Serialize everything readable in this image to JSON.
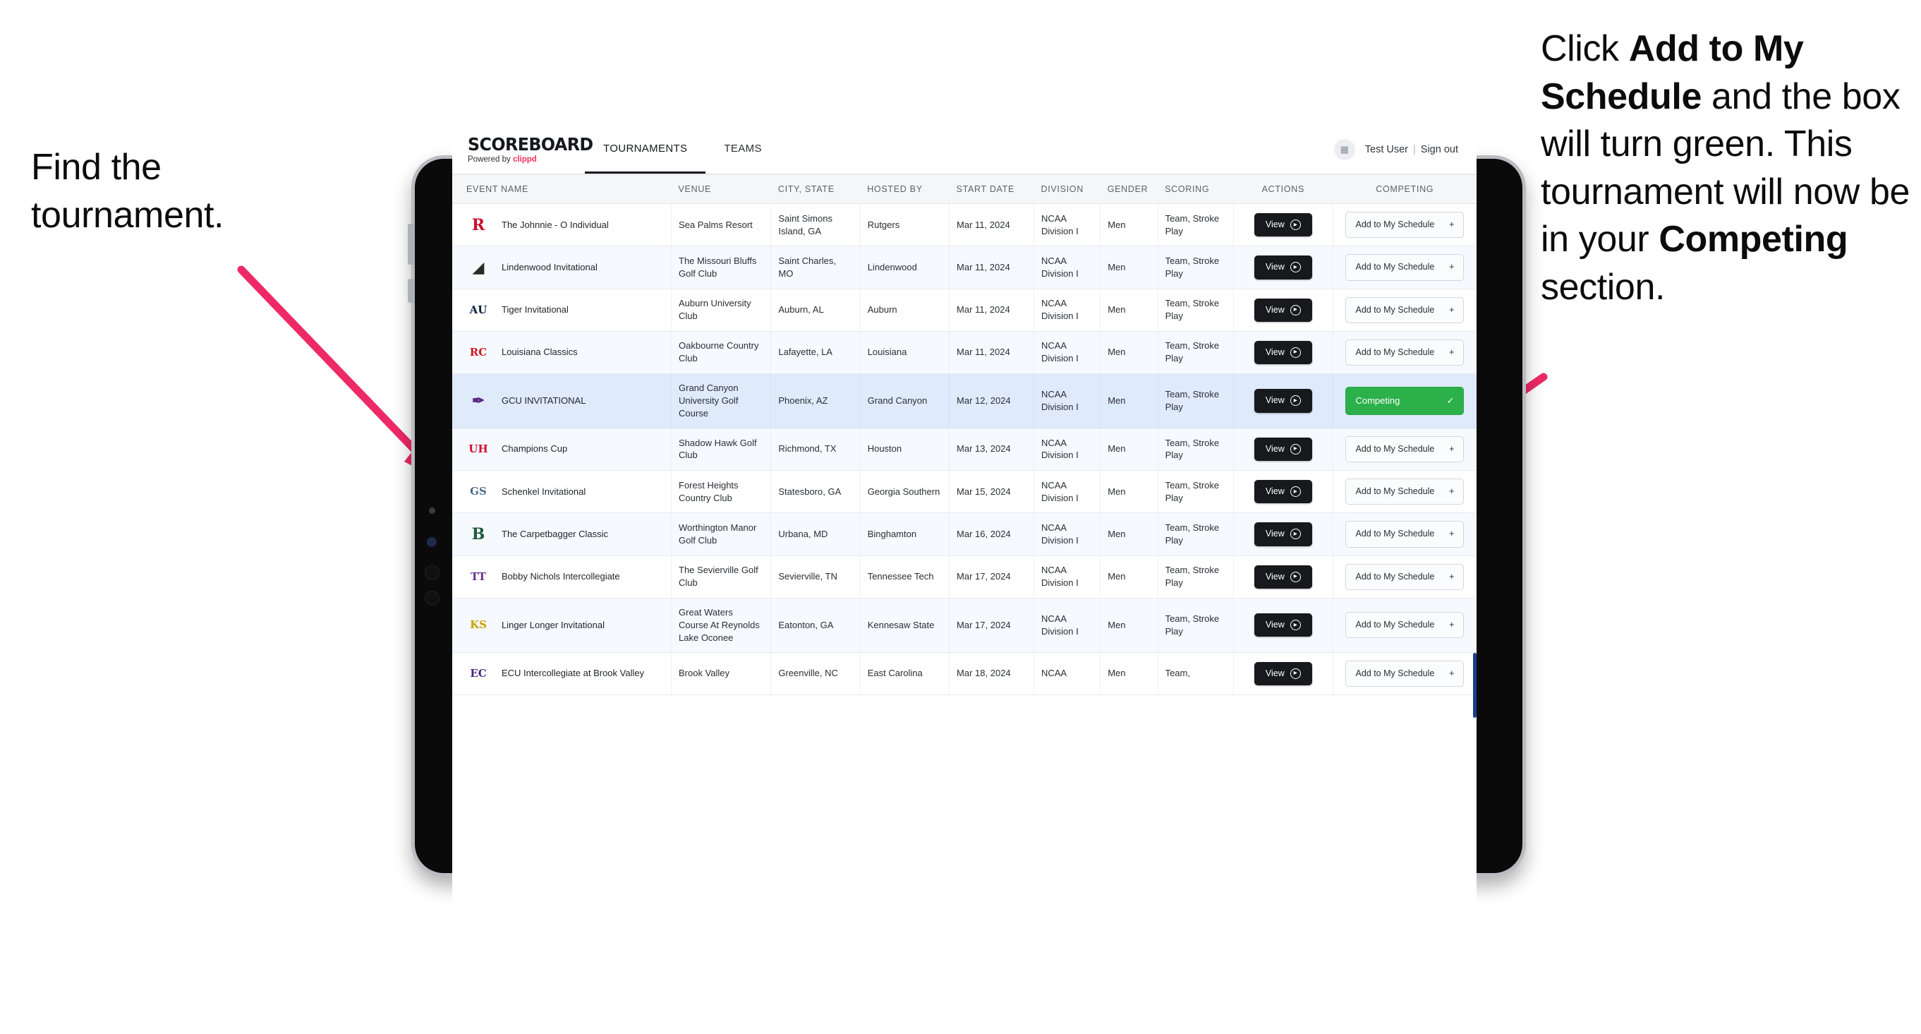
{
  "annotations": {
    "left": "Find the tournament.",
    "right_parts": [
      {
        "text": "Click ",
        "bold": false
      },
      {
        "text": "Add to My Schedule",
        "bold": true
      },
      {
        "text": " and the box will turn green. This tournament will now be in your ",
        "bold": false
      },
      {
        "text": "Competing",
        "bold": true
      },
      {
        "text": " section.",
        "bold": false
      }
    ],
    "arrow_color": "#ED2A67"
  },
  "app": {
    "brand": {
      "title": "SCOREBOARD",
      "powered_prefix": "Powered by ",
      "powered_brand": "clippd"
    },
    "nav": [
      {
        "label": "TOURNAMENTS",
        "active": true
      },
      {
        "label": "TEAMS",
        "active": false
      }
    ],
    "header_right": {
      "avatar_icon": "user-avatar-icon",
      "user_name": "Test User",
      "separator": "|",
      "sign_out": "Sign out"
    },
    "colors": {
      "accent_pink": "#f0325c",
      "competing_green": "#2bb04a",
      "view_black": "#18191c",
      "selected_row": "#dfeaFB"
    },
    "table": {
      "columns": [
        "EVENT NAME",
        "VENUE",
        "CITY, STATE",
        "HOSTED BY",
        "START DATE",
        "DIVISION",
        "GENDER",
        "SCORING",
        "ACTIONS",
        "COMPETING"
      ],
      "view_label": "View",
      "add_label": "Add to My Schedule",
      "add_icon": "plus-icon",
      "competing_label": "Competing",
      "competing_icon": "check-icon",
      "rows": [
        {
          "logo": {
            "text": "R",
            "color": "#c8102e",
            "bg": "transparent",
            "name": "rutgers-logo"
          },
          "event": "The Johnnie - O Individual",
          "venue": "Sea Palms Resort",
          "city": "Saint Simons Island, GA",
          "host": "Rutgers",
          "date": "Mar 11, 2024",
          "division": "NCAA Division I",
          "gender": "Men",
          "scoring": "Team, Stroke Play",
          "competing": false
        },
        {
          "logo": {
            "text": "◢",
            "color": "#2b2a22",
            "bg": "transparent",
            "name": "lindenwood-lion-logo"
          },
          "event": "Lindenwood Invitational",
          "venue": "The Missouri Bluffs Golf Club",
          "city": "Saint Charles, MO",
          "host": "Lindenwood",
          "date": "Mar 11, 2024",
          "division": "NCAA Division I",
          "gender": "Men",
          "scoring": "Team, Stroke Play",
          "competing": false
        },
        {
          "logo": {
            "text": "AU",
            "color": "#0c2340",
            "bg": "transparent",
            "name": "auburn-logo"
          },
          "event": "Tiger Invitational",
          "venue": "Auburn University Club",
          "city": "Auburn, AL",
          "host": "Auburn",
          "date": "Mar 11, 2024",
          "division": "NCAA Division I",
          "gender": "Men",
          "scoring": "Team, Stroke Play",
          "competing": false
        },
        {
          "logo": {
            "text": "RC",
            "color": "#ce181e",
            "bg": "transparent",
            "name": "louisiana-ragin-cajuns-logo"
          },
          "event": "Louisiana Classics",
          "venue": "Oakbourne Country Club",
          "city": "Lafayette, LA",
          "host": "Louisiana",
          "date": "Mar 11, 2024",
          "division": "NCAA Division I",
          "gender": "Men",
          "scoring": "Team, Stroke Play",
          "competing": false
        },
        {
          "logo": {
            "text": "✒",
            "color": "#582c83",
            "bg": "transparent",
            "name": "grand-canyon-lopes-logo"
          },
          "event": "GCU INVITATIONAL",
          "venue": "Grand Canyon University Golf Course",
          "city": "Phoenix, AZ",
          "host": "Grand Canyon",
          "date": "Mar 12, 2024",
          "division": "NCAA Division I",
          "gender": "Men",
          "scoring": "Team, Stroke Play",
          "competing": true
        },
        {
          "logo": {
            "text": "UH",
            "color": "#c8102e",
            "bg": "transparent",
            "name": "houston-logo"
          },
          "event": "Champions Cup",
          "venue": "Shadow Hawk Golf Club",
          "city": "Richmond, TX",
          "host": "Houston",
          "date": "Mar 13, 2024",
          "division": "NCAA Division I",
          "gender": "Men",
          "scoring": "Team, Stroke Play",
          "competing": false
        },
        {
          "logo": {
            "text": "GS",
            "color": "#4a6e8f",
            "bg": "transparent",
            "name": "georgia-southern-logo"
          },
          "event": "Schenkel Invitational",
          "venue": "Forest Heights Country Club",
          "city": "Statesboro, GA",
          "host": "Georgia Southern",
          "date": "Mar 15, 2024",
          "division": "NCAA Division I",
          "gender": "Men",
          "scoring": "Team, Stroke Play",
          "competing": false
        },
        {
          "logo": {
            "text": "B",
            "color": "#1c5a3c",
            "bg": "transparent",
            "name": "binghamton-logo"
          },
          "event": "The Carpetbagger Classic",
          "venue": "Worthington Manor Golf Club",
          "city": "Urbana, MD",
          "host": "Binghamton",
          "date": "Mar 16, 2024",
          "division": "NCAA Division I",
          "gender": "Men",
          "scoring": "Team, Stroke Play",
          "competing": false
        },
        {
          "logo": {
            "text": "TT",
            "color": "#6b2d8b",
            "bg": "transparent",
            "name": "tennessee-tech-golden-eagle-logo"
          },
          "event": "Bobby Nichols Intercollegiate",
          "venue": "The Sevierville Golf Club",
          "city": "Sevierville, TN",
          "host": "Tennessee Tech",
          "date": "Mar 17, 2024",
          "division": "NCAA Division I",
          "gender": "Men",
          "scoring": "Team, Stroke Play",
          "competing": false
        },
        {
          "logo": {
            "text": "KS",
            "color": "#c8a200",
            "bg": "transparent",
            "name": "kennesaw-state-logo"
          },
          "event": "Linger Longer Invitational",
          "venue": "Great Waters Course At Reynolds Lake Oconee",
          "city": "Eatonton, GA",
          "host": "Kennesaw State",
          "date": "Mar 17, 2024",
          "division": "NCAA Division I",
          "gender": "Men",
          "scoring": "Team, Stroke Play",
          "competing": false
        },
        {
          "logo": {
            "text": "EC",
            "color": "#4b2682",
            "bg": "transparent",
            "name": "east-carolina-logo"
          },
          "event": "ECU Intercollegiate at Brook Valley",
          "venue": "Brook Valley",
          "city": "Greenville, NC",
          "host": "East Carolina",
          "date": "Mar 18, 2024",
          "division": "NCAA",
          "gender": "Men",
          "scoring": "Team,",
          "competing": false
        }
      ]
    }
  }
}
